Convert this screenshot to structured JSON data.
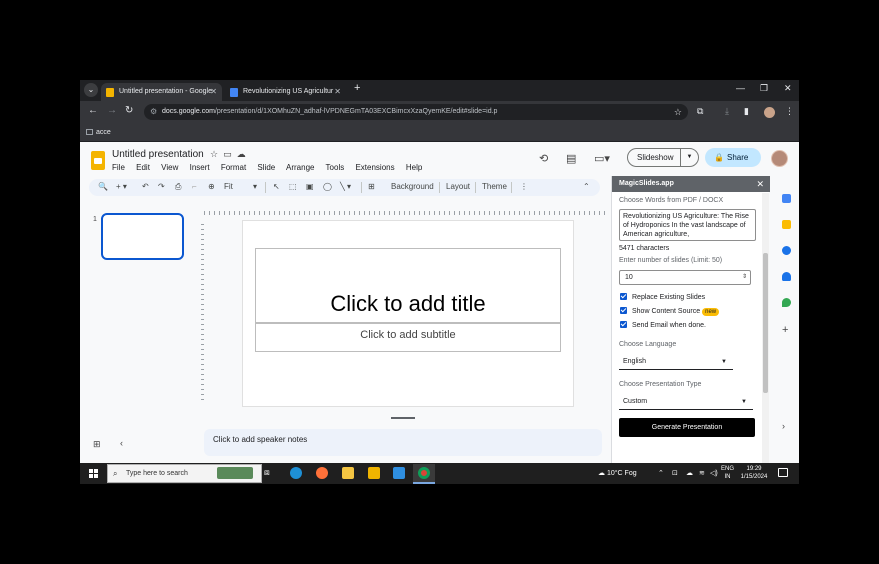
{
  "browser": {
    "tabs": [
      {
        "title": "Untitled presentation - Google",
        "active": true,
        "favicon_color": "#f4b400"
      },
      {
        "title": "Revolutionizing US Agricultur",
        "active": false,
        "favicon_color": "#4285f4"
      }
    ],
    "url_host": "docs.google.com",
    "url_path": "/presentation/d/1XOMhuZN_adhaf-lVPDNEGmTA03EXCBimcxXzaQyemKE/edit#slide=id.p",
    "bookmark": "acce"
  },
  "app": {
    "doc_title": "Untitled presentation",
    "menu": [
      "File",
      "Edit",
      "View",
      "Insert",
      "Format",
      "Slide",
      "Arrange",
      "Tools",
      "Extensions",
      "Help"
    ],
    "slideshow_label": "Slideshow",
    "share_label": "Share",
    "toolbar": {
      "zoom": "Fit",
      "background": "Background",
      "layout": "Layout",
      "theme": "Theme"
    },
    "slide_number": "1",
    "title_placeholder": "Click to add title",
    "subtitle_placeholder": "Click to add subtitle",
    "notes_placeholder": "Click to add speaker notes"
  },
  "panel": {
    "header": "MagicSlides.app",
    "source_label": "Choose Words from PDF / DOCX",
    "source_text": "Revolutionizing US Agriculture: The Rise of Hydroponics In the vast landscape of American agriculture,",
    "char_count": "5471 characters",
    "slides_label": "Enter number of slides (Limit: 50)",
    "slides_value": "10",
    "options": [
      {
        "label": "Replace Existing Slides",
        "checked": true,
        "badge": ""
      },
      {
        "label": "Show Content Source",
        "checked": true,
        "badge": "new"
      },
      {
        "label": "Send Email when done.",
        "checked": true,
        "badge": ""
      }
    ],
    "language_label": "Choose Language",
    "language_value": "English",
    "type_label": "Choose Presentation Type",
    "type_value": "Custom",
    "generate_label": "Generate Presentation"
  },
  "taskbar": {
    "search_placeholder": "Type here to search",
    "weather": "10°C  Fog",
    "lang_line1": "ENG",
    "lang_line2": "IN",
    "time": "19:29",
    "date": "1/15/2024"
  },
  "colors": {
    "accent": "#0b57d0",
    "share_bg": "#c2e7ff",
    "slides_logo": "#f4b400",
    "panel_header": "#5f6368"
  }
}
